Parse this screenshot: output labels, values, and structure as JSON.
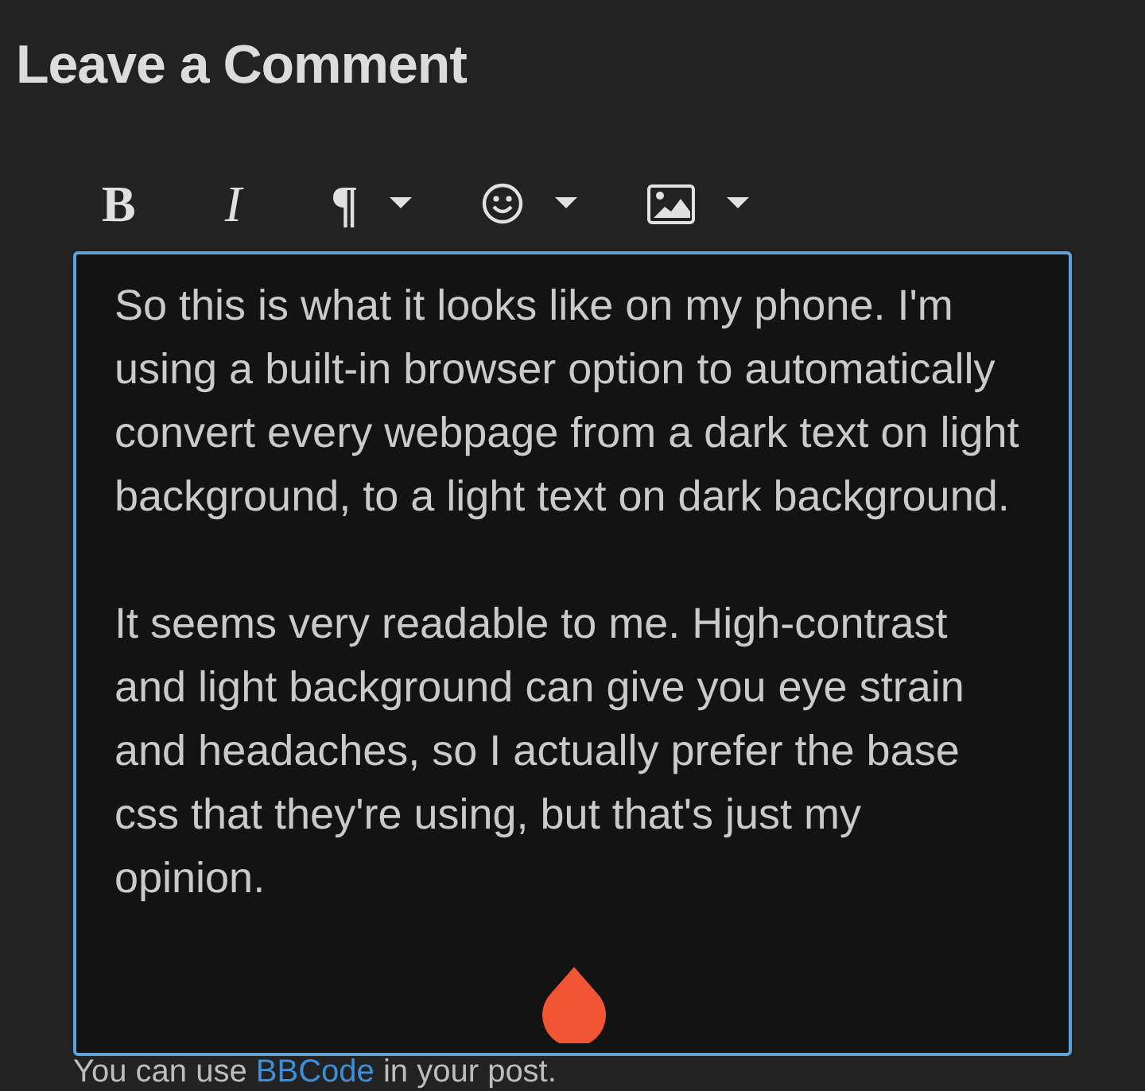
{
  "title": "Leave a Comment",
  "toolbar": [
    {
      "kind": "bold",
      "label": "B",
      "dropdown": false
    },
    {
      "kind": "italic",
      "label": "I",
      "dropdown": false
    },
    {
      "kind": "paragraph",
      "label": "¶",
      "dropdown": true
    },
    {
      "kind": "emoji",
      "dropdown": true
    },
    {
      "kind": "image",
      "dropdown": true
    }
  ],
  "editor": {
    "focused": true,
    "value": "So this is what it looks like on my phone. I'm using a built-in browser option to automatically convert every webpage from a dark text on light background, to a light text on dark background.\n\nIt seems very readable to me. High-contrast and light background can give you eye strain and headaches, so I actually prefer the base css that they're using, but that's just my opinion."
  },
  "hint": {
    "before": "You can use ",
    "link": "BBCode",
    "after": " in your post."
  }
}
